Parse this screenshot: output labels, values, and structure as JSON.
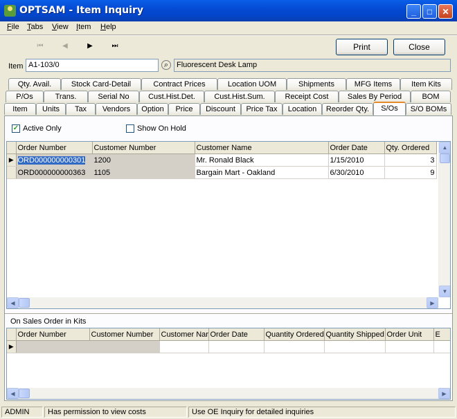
{
  "window": {
    "title": "OPTSAM - Item Inquiry",
    "minimize": "_",
    "maximize": "□",
    "close": "✕"
  },
  "menu": [
    "File",
    "Tabs",
    "View",
    "Item",
    "Help"
  ],
  "toolbar": {
    "first": "⏮",
    "prev": "◀",
    "next": "▶",
    "last": "⏭",
    "print": "Print",
    "close": "Close"
  },
  "item": {
    "label": "Item",
    "value": "A1-103/0",
    "lookup": "⌕",
    "description": "Fluorescent Desk Lamp"
  },
  "tabs": {
    "row1": [
      "Qty. Avail.",
      "Stock Card-Detail",
      "Contract Prices",
      "Location UOM",
      "Shipments",
      "MFG Items",
      "Item Kits"
    ],
    "row2": [
      "P/Os",
      "Trans.",
      "Serial No",
      "Cust.Hist.Det.",
      "Cust.Hist.Sum.",
      "Receipt Cost",
      "Sales By Period",
      "BOM"
    ],
    "row3": [
      "Item",
      "Units",
      "Tax",
      "Vendors",
      "Option",
      "Price",
      "Discount",
      "Price Tax",
      "Location",
      "Reorder Qty.",
      "S/Os",
      "S/O BOMs"
    ],
    "selected": "S/Os"
  },
  "filters": {
    "active_only": "Active Only",
    "active_only_checked": "✓",
    "show_on_hold": "Show On Hold"
  },
  "orders": {
    "columns": [
      "Order Number",
      "Customer Number",
      "Customer Name",
      "Order Date",
      "Qty. Ordered"
    ],
    "rows": [
      [
        "ORD000000000301",
        "1200",
        "Mr. Ronald Black",
        "1/15/2010",
        "3"
      ],
      [
        "ORD000000000363",
        "1105",
        "Bargain Mart - Oakland",
        "6/30/2010",
        "9"
      ]
    ]
  },
  "kits": {
    "title": "On Sales Order in Kits",
    "columns": [
      "Order Number",
      "Customer Number",
      "Customer Nar",
      "Order Date",
      "Quantity Ordered",
      "Quantity Shipped",
      "Order Unit",
      "E"
    ]
  },
  "status": {
    "user": "ADMIN",
    "permission": "Has permission to view costs",
    "hint": "Use OE Inquiry for detailed inquiries"
  }
}
